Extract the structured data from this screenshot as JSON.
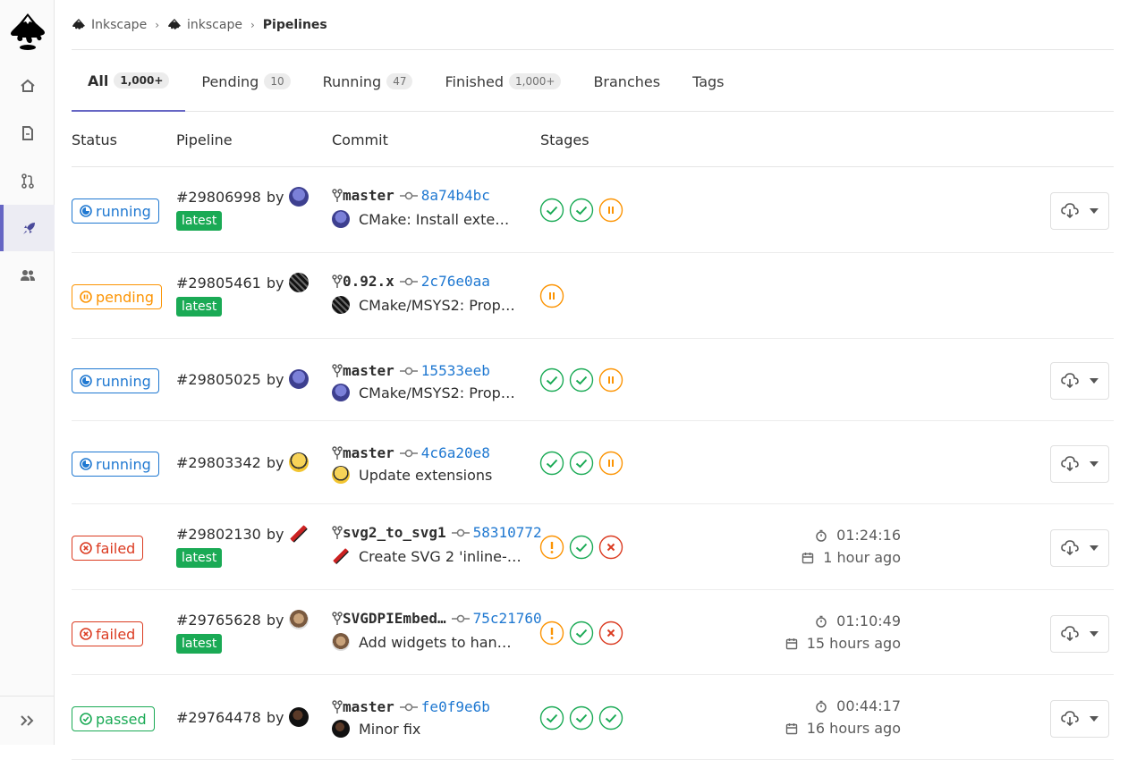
{
  "breadcrumb": [
    {
      "label": "Inkscape"
    },
    {
      "label": "inkscape"
    },
    {
      "label": "Pipelines"
    }
  ],
  "tabs": [
    {
      "label": "All",
      "count": "1,000+"
    },
    {
      "label": "Pending",
      "count": "10"
    },
    {
      "label": "Running",
      "count": "47"
    },
    {
      "label": "Finished",
      "count": "1,000+"
    },
    {
      "label": "Branches",
      "count": ""
    },
    {
      "label": "Tags",
      "count": ""
    }
  ],
  "columns": {
    "status": "Status",
    "pipeline": "Pipeline",
    "commit": "Commit",
    "stages": "Stages"
  },
  "colors": {
    "accent": "#6666c4",
    "running": "#1f78d1",
    "pending": "#fc9403",
    "failed": "#db3b21",
    "passed": "#1aaa55"
  },
  "rows": [
    {
      "status": "running",
      "id": "#29806998",
      "by": "by",
      "latest": "latest",
      "branch": "master",
      "sha": "8a74b4bc",
      "message": "CMake: Install exte…",
      "stages": [
        "success",
        "success",
        "pending"
      ],
      "duration": "",
      "finished": "",
      "download": true
    },
    {
      "status": "pending",
      "id": "#29805461",
      "by": "by",
      "latest": "latest",
      "branch": "0.92.x",
      "sha": "2c76e0aa",
      "message": "CMake/MSYS2: Prop…",
      "stages": [
        "pending"
      ],
      "duration": "",
      "finished": "",
      "download": false
    },
    {
      "status": "running",
      "id": "#29805025",
      "by": "by",
      "latest": "",
      "branch": "master",
      "sha": "15533eeb",
      "message": "CMake/MSYS2: Prop…",
      "stages": [
        "success",
        "success",
        "pending"
      ],
      "duration": "",
      "finished": "",
      "download": true
    },
    {
      "status": "running",
      "id": "#29803342",
      "by": "by",
      "latest": "",
      "branch": "master",
      "sha": "4c6a20e8",
      "message": "Update extensions",
      "stages": [
        "success",
        "success",
        "pending"
      ],
      "duration": "",
      "finished": "",
      "download": true
    },
    {
      "status": "failed",
      "id": "#29802130",
      "by": "by",
      "latest": "latest",
      "branch": "svg2_to_svg1",
      "sha": "58310772",
      "message": "Create SVG 2 'inline-…",
      "stages": [
        "warning",
        "success",
        "failed"
      ],
      "duration": "01:24:16",
      "finished": "1 hour ago",
      "download": true
    },
    {
      "status": "failed",
      "id": "#29765628",
      "by": "by",
      "latest": "latest",
      "branch": "SVGDPIEmbed…",
      "sha": "75c21760",
      "message": "Add widgets to han…",
      "stages": [
        "warning",
        "success",
        "failed"
      ],
      "duration": "01:10:49",
      "finished": "15 hours ago",
      "download": true
    },
    {
      "status": "passed",
      "id": "#29764478",
      "by": "by",
      "latest": "",
      "branch": "master",
      "sha": "fe0f9e6b",
      "message": "Minor fix",
      "stages": [
        "success",
        "success",
        "success"
      ],
      "duration": "00:44:17",
      "finished": "16 hours ago",
      "download": true
    }
  ]
}
